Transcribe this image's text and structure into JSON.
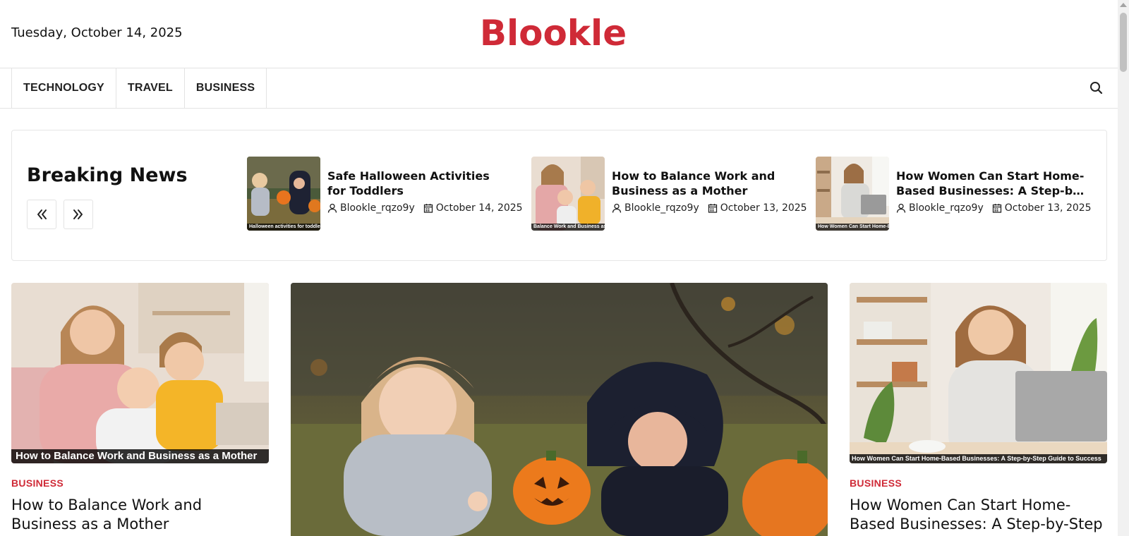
{
  "header": {
    "date": "Tuesday, October 14, 2025",
    "logo": "Blookle"
  },
  "nav": {
    "items": [
      {
        "label": "TECHNOLOGY"
      },
      {
        "label": "TRAVEL"
      },
      {
        "label": "BUSINESS"
      }
    ],
    "search_icon": "search-icon"
  },
  "breaking": {
    "title": "Breaking News",
    "prev_icon": "double-chevron-left-icon",
    "next_icon": "double-chevron-right-icon",
    "items": [
      {
        "title": "Safe Halloween Activities for Toddlers",
        "thumb_caption": "Halloween activities for toddlers",
        "author": "Blookle_rqzo9y",
        "date": "October 14, 2025"
      },
      {
        "title": "How to Balance Work and Business as a Mother",
        "thumb_caption": "Balance Work and Business as a Mother",
        "author": "Blookle_rqzo9y",
        "date": "October 13, 2025"
      },
      {
        "title": "How Women Can Start Home-Based Businesses: A Step-by-Ste...",
        "thumb_caption": "How Women Can Start Home-Based Businesses: A Step-by-Step Guide",
        "author": "Blookle_rqzo9y",
        "date": "October 13, 2025"
      }
    ]
  },
  "cards": {
    "left": {
      "caption": "How to Balance Work and Business as a Mother",
      "category": "BUSINESS",
      "title": "How to Balance Work and Business as a Mother"
    },
    "right": {
      "caption": "How Women Can Start Home-Based Businesses: A Step-by-Step Guide to Success",
      "category": "BUSINESS",
      "title": "How Women Can Start Home-Based Businesses: A Step-by-Step Guide to"
    }
  },
  "colors": {
    "brand": "#cf2a37",
    "border": "#e3e3e3"
  }
}
